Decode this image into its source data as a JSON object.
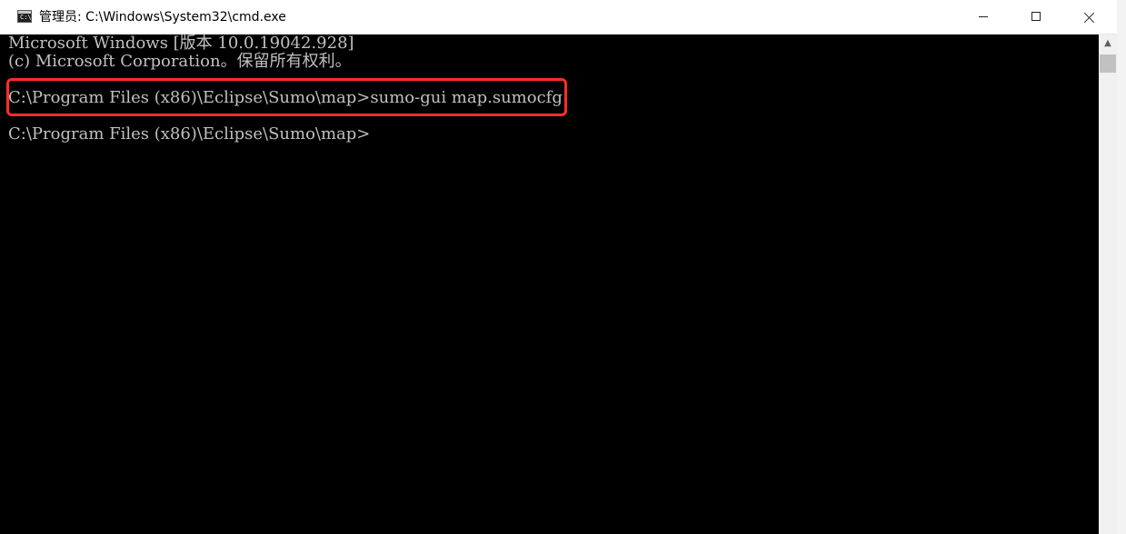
{
  "window": {
    "title": "管理员: C:\\Windows\\System32\\cmd.exe",
    "icon": "cmd-icon",
    "icon_glyph": "C:\\",
    "controls": {
      "minimize": "minimize-icon",
      "maximize": "maximize-icon",
      "close": "close-icon"
    }
  },
  "console": {
    "lines": [
      "Microsoft Windows [版本 10.0.19042.928]",
      "(c) Microsoft Corporation。保留所有权利。",
      "C:\\Program Files (x86)\\Eclipse\\Sumo\\map>sumo-gui map.sumocfg",
      "C:\\Program Files (x86)\\Eclipse\\Sumo\\map>"
    ],
    "highlight_color": "#ff2d2d"
  },
  "scrollbar": {
    "up_arrow": "▲"
  }
}
